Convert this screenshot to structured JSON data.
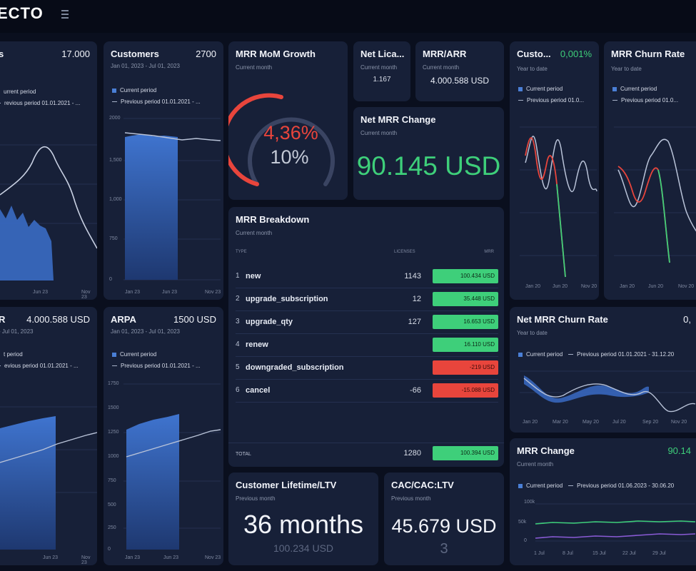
{
  "app": {
    "logo_text": "ECTO",
    "menu_icon": "hamburger-icon"
  },
  "colors": {
    "accent_blue": "#4a7fd6",
    "green": "#3ecf7a",
    "red": "#e8453c",
    "bg": "#0a0f1e",
    "card": "#172038"
  },
  "cards": {
    "c1": {
      "title": "s",
      "value": "17.000"
    },
    "customers": {
      "title": "Customers",
      "value": "2700",
      "subtitle": "Jan 01, 2023 - Jul 01, 2023",
      "legend_current": "Current period",
      "legend_previous": "Previous period 01.01.2021 - ...",
      "y_ticks": [
        "2000",
        "1,500",
        "1,000",
        "750",
        "0"
      ],
      "x_ticks": [
        "Jan 23",
        "Jun 23",
        "Nov 23"
      ]
    },
    "mom": {
      "title": "MRR MoM Growth",
      "subtitle": "Current month",
      "pct": "4,36%",
      "target": "10%",
      "gauge_fraction": 0.44
    },
    "netlic": {
      "title": "Net Lica...",
      "subtitle": "Current month",
      "value": "1.167"
    },
    "mrrarr": {
      "title": "MRR/ARR",
      "subtitle": "Current month",
      "value": "4.000.588 USD"
    },
    "netchange": {
      "title": "Net MRR Change",
      "subtitle": "Current month",
      "value": "90.145 USD"
    },
    "custo": {
      "title": "Custo...",
      "value": "0,001%",
      "subtitle": "Year to date",
      "legend_current": "Current period",
      "legend_previous": "Previous period 01.0...",
      "x_ticks": [
        "Jan 20",
        "Jun 20",
        "Nov 20"
      ]
    },
    "churn": {
      "title": "MRR Churn Rate",
      "subtitle": "Year to date",
      "legend_current": "Current period",
      "legend_previous": "Previous period 01.0...",
      "x_ticks": [
        "Jan 20",
        "Jun 20",
        "Nov 20"
      ]
    },
    "c5": {
      "title": "R",
      "value": "4.000.588 USD",
      "subtitle": "- Jul 01, 2023",
      "legend_current": "t period",
      "legend_previous": "evious period 01.01.2021 - ...",
      "x_ticks": [
        "Jan 23",
        "Jun 23",
        "Nov 23"
      ]
    },
    "arpa": {
      "title": "ARPA",
      "value": "1500 USD",
      "subtitle": "Jan 01, 2023 - Jul 01, 2023",
      "legend_current": "Current period",
      "legend_previous": "Previous period 01.01.2021 - ...",
      "y_ticks": [
        "1750",
        "1500",
        "1250",
        "1000",
        "750",
        "500",
        "250",
        "0"
      ],
      "x_ticks": [
        "Jan 23",
        "Jun 23",
        "Nov 23"
      ]
    },
    "netchurn": {
      "title": "Net MRR Churn Rate",
      "value": "0,",
      "subtitle": "Year to date",
      "legend_current": "Current period",
      "legend_previous": "Previous period 01.01.2021 - 31.12.20",
      "x_ticks": [
        "Jan 20",
        "Mar 20",
        "May 20",
        "Jul 20",
        "Sep 20",
        "Nov 20"
      ]
    },
    "mrrchange": {
      "title": "MRR Change",
      "value": "90.14",
      "subtitle": "Current month",
      "legend_current": "Current period",
      "legend_previous": "Previous period 01.06.2023 - 30.06.20",
      "y_ticks": [
        "100k",
        "50k",
        "0"
      ],
      "x_ticks": [
        "1 Jul",
        "8 Jul",
        "15 Jul",
        "22 Jul",
        "29 Jul"
      ]
    },
    "ltv": {
      "title": "Customer Lifetime/LTV",
      "subtitle": "Previous month",
      "value": "36 months",
      "sub_value": "100.234 USD"
    },
    "cac": {
      "title": "CAC/CAC:LTV",
      "subtitle": "Previous month",
      "value": "45.679 USD",
      "sub_value": "3"
    }
  },
  "breakdown": {
    "title": "MRR Breakdown",
    "subtitle": "Current month",
    "col_type": "TYPE",
    "col_lic": "LICENSES",
    "col_mrr": "MRR",
    "rows": [
      {
        "idx": "1",
        "type": "new",
        "lic": "1143",
        "mrr": "100.434 USD",
        "status": "positive"
      },
      {
        "idx": "2",
        "type": "upgrade_subscription",
        "lic": "12",
        "mrr": "35.448 USD",
        "status": "positive"
      },
      {
        "idx": "3",
        "type": "upgrade_qty",
        "lic": "127",
        "mrr": "16.653 USD",
        "status": "positive"
      },
      {
        "idx": "4",
        "type": "renew",
        "lic": "",
        "mrr": "16.110 USD",
        "status": "positive"
      },
      {
        "idx": "5",
        "type": "downgraded_subscription",
        "lic": "",
        "mrr": "-219 USD",
        "status": "negative"
      },
      {
        "idx": "6",
        "type": "cancel",
        "lic": "-66",
        "mrr": "-15.088 USD",
        "status": "negative"
      }
    ],
    "total_label": "TOTAL",
    "total_lic": "1280",
    "total_mrr": "100.394 USD"
  }
}
